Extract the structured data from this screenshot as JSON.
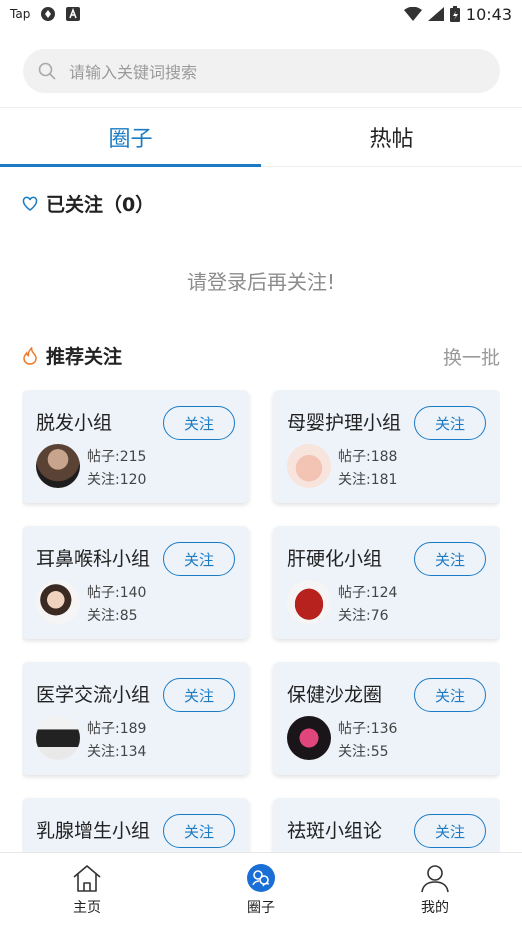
{
  "status_bar": {
    "left_label": "Tap",
    "time": "10:43"
  },
  "search": {
    "placeholder": "请输入关键词搜索"
  },
  "tabs": [
    {
      "label": "圈子",
      "active": true
    },
    {
      "label": "热帖",
      "active": false
    }
  ],
  "followed": {
    "title": "已关注（0）",
    "tip": "请登录后再关注!"
  },
  "recommend": {
    "title": "推荐关注",
    "refresh_label": "换一批"
  },
  "follow_label": "关注",
  "groups": [
    {
      "name": "脱发小组",
      "posts": "帖子:215",
      "followers": "关注:120"
    },
    {
      "name": "母婴护理小组",
      "posts": "帖子:188",
      "followers": "关注:181"
    },
    {
      "name": "耳鼻喉科小组",
      "posts": "帖子:140",
      "followers": "关注:85"
    },
    {
      "name": "肝硬化小组",
      "posts": "帖子:124",
      "followers": "关注:76"
    },
    {
      "name": "医学交流小组",
      "posts": "帖子:189",
      "followers": "关注:134"
    },
    {
      "name": "保健沙龙圈",
      "posts": "帖子:136",
      "followers": "关注:55"
    },
    {
      "name": "乳腺增生小组",
      "posts": "",
      "followers": ""
    },
    {
      "name": "祛斑小组论",
      "posts": "",
      "followers": ""
    }
  ],
  "bottom_nav": [
    {
      "label": "主页",
      "icon": "home-icon"
    },
    {
      "label": "圈子",
      "icon": "circle-icon"
    },
    {
      "label": "我的",
      "icon": "user-icon"
    }
  ],
  "colors": {
    "accent": "#1a7bc4",
    "card_bg": "#eef3fa",
    "flame": "#f07a2a"
  }
}
